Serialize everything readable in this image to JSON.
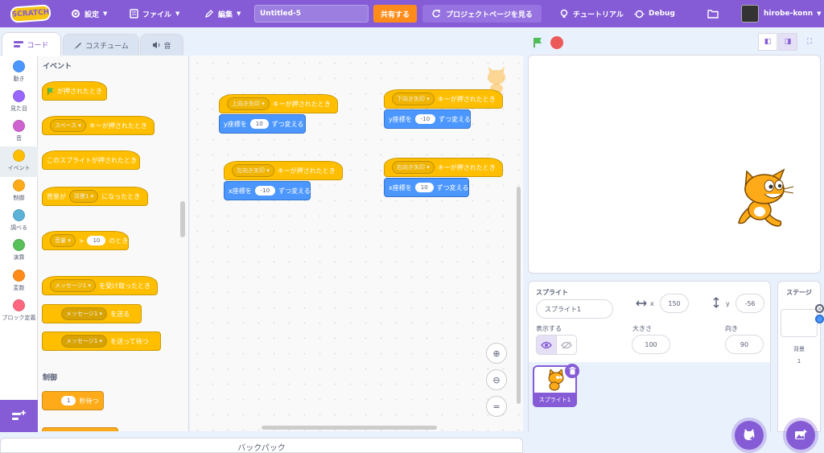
{
  "menu": {
    "logo": "SCRATCH",
    "settings": "設定",
    "file": "ファイル",
    "edit": "編集",
    "project_title": "Untitled-5",
    "share": "共有する",
    "project_page": "プロジェクトページを見る",
    "tutorial": "チュートリアル",
    "debug": "Debug",
    "username": "hirobe-konn"
  },
  "tabs": [
    "コード",
    "コスチューム",
    "音"
  ],
  "categories": [
    {
      "label": "動き",
      "color": "#4c97ff"
    },
    {
      "label": "見た目",
      "color": "#9966ff"
    },
    {
      "label": "音",
      "color": "#cf63cf"
    },
    {
      "label": "イベント",
      "color": "#ffbf00"
    },
    {
      "label": "制御",
      "color": "#ffab19"
    },
    {
      "label": "調べる",
      "color": "#5cb1d6"
    },
    {
      "label": "演算",
      "color": "#59c059"
    },
    {
      "label": "変数",
      "color": "#ff8c1a"
    },
    {
      "label": "ブロック定義",
      "color": "#ff6680"
    }
  ],
  "palette": {
    "events_title": "イベント",
    "flag_clicked": "が押されたとき",
    "key_space": "スペース",
    "key_pressed": "キーが押されたとき",
    "sprite_clicked": "このスプライトが押されたとき",
    "backdrop_prefix": "背景が",
    "backdrop_value": "背景1",
    "backdrop_suffix": "になったとき",
    "volume": "音量",
    "gt": ">",
    "volume_value": "10",
    "when_suffix": "のとき",
    "message1": "メッセージ1",
    "receive": "を受け取ったとき",
    "broadcast": "を送る",
    "broadcast_wait": "を送って待つ",
    "control_title": "制御",
    "wait_value": "1",
    "wait_label": "秒待つ"
  },
  "scripts": [
    {
      "key": "上向き矢印",
      "hat": "キーが押されたとき",
      "coord": "y座標を",
      "value": "10",
      "action": "ずつ変える"
    },
    {
      "key": "下向き矢印",
      "hat": "キーが押されたとき",
      "coord": "y座標を",
      "value": "-10",
      "action": "ずつ変える"
    },
    {
      "key": "左向き矢印",
      "hat": "キーが押されたとき",
      "coord": "x座標を",
      "value": "-10",
      "action": "ずつ変える"
    },
    {
      "key": "右向き矢印",
      "hat": "キーが押されたとき",
      "coord": "x座標を",
      "value": "10",
      "action": "ずつ変える"
    }
  ],
  "backpack": "バックパック",
  "sprite_info": {
    "sprite_label": "スプライト",
    "sprite_name": "スプライト1",
    "x_label": "x",
    "x_value": "150",
    "y_label": "y",
    "y_value": "-56",
    "show_label": "表示する",
    "size_label": "大きさ",
    "size_value": "100",
    "direction_label": "向き",
    "direction_value": "90"
  },
  "sprite_tile_name": "スプライト1",
  "stage_panel": {
    "title": "ステージ",
    "backdrops_label": "背景",
    "backdrops_count": "1"
  },
  "colors": {
    "menu_purple": "#855cd6",
    "event_yellow": "#ffbf00",
    "motion_blue": "#4c97ff",
    "share_orange": "#ff8c1a"
  }
}
